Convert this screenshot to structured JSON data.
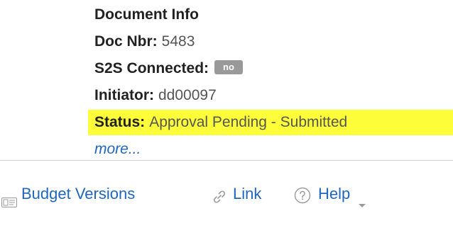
{
  "document_info": {
    "title": "Document Info",
    "doc_nbr_label": "Doc Nbr:",
    "doc_nbr_value": "5483",
    "s2s_label": "S2S Connected:",
    "s2s_badge": "no",
    "initiator_label": "Initiator:",
    "initiator_value": "dd00097",
    "status_label": "Status:",
    "status_value": "Approval Pending - Submitted",
    "more_link": "more..."
  },
  "toolbar": {
    "budget_versions": {
      "label": "Budget Versions",
      "icon": "budget-versions-icon"
    },
    "link": {
      "label": "Link",
      "icon": "link-icon"
    },
    "help": {
      "label": "Help",
      "icon": "help-icon"
    }
  },
  "colors": {
    "link": "#1f66c0",
    "highlight": "#fdfd3a",
    "badge": "#999999"
  }
}
